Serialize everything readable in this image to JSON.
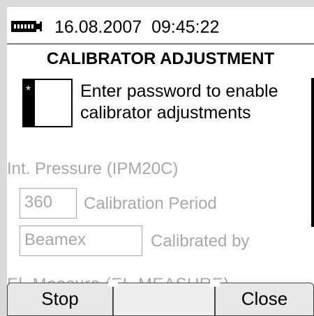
{
  "status_bar": {
    "date": "16.08.2007",
    "time": "09:45:22",
    "battery_icon": "battery-charging-icon"
  },
  "page": {
    "title": "CALIBRATOR ADJUSTMENT"
  },
  "password": {
    "value": "*",
    "prompt": "Enter password to enable calibrator adjustments"
  },
  "module": {
    "label": "Int. Pressure (IPM20C)",
    "calibration_period_value": "360",
    "calibration_period_label": "Calibration Period",
    "calibrated_by_value": "Beamex",
    "calibrated_by_label": "Calibrated by"
  },
  "next_module": {
    "label_cut": "El. Measure (EL-MEASURE)"
  },
  "softkeys": {
    "left": "Stop",
    "middle": "",
    "right": "Close"
  },
  "colors": {
    "disabled_text": "#a8a8a8",
    "screen_bg": "#ffffff",
    "frame_bg": "#d9d9d9",
    "softkey_bg": "#e8e8e8"
  }
}
